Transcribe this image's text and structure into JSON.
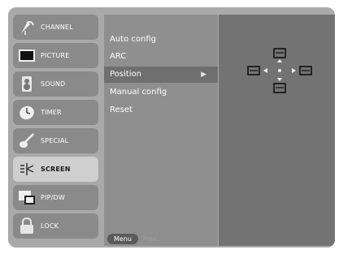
{
  "sidebar": {
    "items": [
      {
        "label": "CHANNEL",
        "icon": "satellite-dish-icon"
      },
      {
        "label": "PICTURE",
        "icon": "tv-screen-icon"
      },
      {
        "label": "SOUND",
        "icon": "speaker-icon"
      },
      {
        "label": "TIMER",
        "icon": "clock-icon"
      },
      {
        "label": "SPECIAL",
        "icon": "guitar-icon"
      },
      {
        "label": "SCREEN",
        "icon": "screen-adjust-icon",
        "active": true
      },
      {
        "label": "PIP/DW",
        "icon": "picture-in-picture-icon"
      },
      {
        "label": "LOCK",
        "icon": "padlock-icon"
      }
    ]
  },
  "submenu": {
    "items": [
      {
        "label": "Auto config"
      },
      {
        "label": "ARC"
      },
      {
        "label": "Position",
        "active": true,
        "arrow": "▶"
      },
      {
        "label": "Manual config"
      },
      {
        "label": "Reset"
      }
    ]
  },
  "footer": {
    "menu_label": "Menu",
    "prev_label": "Prev."
  },
  "colors": {
    "frame": "#bdbdbd",
    "sidebar_item": "#8a8a8a",
    "sidebar_active": "#cfcfcf",
    "submenu_bg": "#8f8f8f",
    "submenu_active": "#6f6f6f",
    "preview_bg": "#737373"
  }
}
